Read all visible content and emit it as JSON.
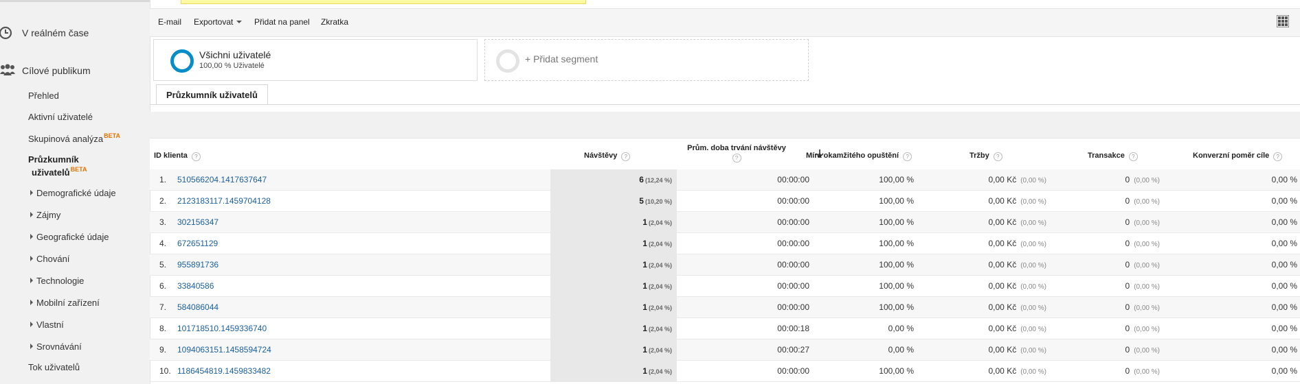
{
  "sidebar": {
    "realtime_label": "V reálném čase",
    "audience_label": "Cílové publikum",
    "items": [
      {
        "label": "Přehled"
      },
      {
        "label": "Aktivní uživatelé"
      },
      {
        "label": "Skupinová analýza",
        "badge": "BETA"
      },
      {
        "label_line1": "Průzkumník",
        "label_line2": "uživatelů",
        "badge": "BETA"
      },
      {
        "label": "Demografické údaje"
      },
      {
        "label": "Zájmy"
      },
      {
        "label": "Geografické údaje"
      },
      {
        "label": "Chování"
      },
      {
        "label": "Technologie"
      },
      {
        "label": "Mobilní zařízení"
      },
      {
        "label": "Vlastní"
      },
      {
        "label": "Srovnávání"
      },
      {
        "label": "Tok uživatelů"
      }
    ]
  },
  "toolbar": {
    "email": "E-mail",
    "export": "Exportovat",
    "add_to_dashboard": "Přidat na panel",
    "shortcut": "Zkratka"
  },
  "segments": {
    "all_users_title": "Všichni uživatelé",
    "all_users_sub": "100,00 % Uživatelé",
    "add_segment": "+ Přidat segment"
  },
  "tab": {
    "label": "Průzkumník uživatelů"
  },
  "table": {
    "headers": {
      "client_id": "ID klienta",
      "visits": "Návštěvy",
      "avg_duration": "Prům. doba trvání návštěvy",
      "bounce_rate": "Míra okamžitého opuštění",
      "revenue": "Tržby",
      "transactions": "Transakce",
      "conversion": "Konverzní poměr cíle"
    },
    "rows": [
      {
        "idx": "1.",
        "id": "510566204.1417637647",
        "visits": "6",
        "visits_pct": "(12,24 %)",
        "duration": "00:00:00",
        "bounce": "100,00 %",
        "revenue": "0,00 Kč",
        "revenue_pct": "(0,00 %)",
        "trans": "0",
        "trans_pct": "(0,00 %)",
        "conv": "0,00 %"
      },
      {
        "idx": "2.",
        "id": "2123183117.1459704128",
        "visits": "5",
        "visits_pct": "(10,20 %)",
        "duration": "00:00:00",
        "bounce": "100,00 %",
        "revenue": "0,00 Kč",
        "revenue_pct": "(0,00 %)",
        "trans": "0",
        "trans_pct": "(0,00 %)",
        "conv": "0,00 %"
      },
      {
        "idx": "3.",
        "id": "302156347",
        "visits": "1",
        "visits_pct": "(2,04 %)",
        "duration": "00:00:00",
        "bounce": "100,00 %",
        "revenue": "0,00 Kč",
        "revenue_pct": "(0,00 %)",
        "trans": "0",
        "trans_pct": "(0,00 %)",
        "conv": "0,00 %"
      },
      {
        "idx": "4.",
        "id": "672651129",
        "visits": "1",
        "visits_pct": "(2,04 %)",
        "duration": "00:00:00",
        "bounce": "100,00 %",
        "revenue": "0,00 Kč",
        "revenue_pct": "(0,00 %)",
        "trans": "0",
        "trans_pct": "(0,00 %)",
        "conv": "0,00 %"
      },
      {
        "idx": "5.",
        "id": "955891736",
        "visits": "1",
        "visits_pct": "(2,04 %)",
        "duration": "00:00:00",
        "bounce": "100,00 %",
        "revenue": "0,00 Kč",
        "revenue_pct": "(0,00 %)",
        "trans": "0",
        "trans_pct": "(0,00 %)",
        "conv": "0,00 %"
      },
      {
        "idx": "6.",
        "id": "33840586",
        "visits": "1",
        "visits_pct": "(2,04 %)",
        "duration": "00:00:00",
        "bounce": "100,00 %",
        "revenue": "0,00 Kč",
        "revenue_pct": "(0,00 %)",
        "trans": "0",
        "trans_pct": "(0,00 %)",
        "conv": "0,00 %"
      },
      {
        "idx": "7.",
        "id": "584086044",
        "visits": "1",
        "visits_pct": "(2,04 %)",
        "duration": "00:00:00",
        "bounce": "100,00 %",
        "revenue": "0,00 Kč",
        "revenue_pct": "(0,00 %)",
        "trans": "0",
        "trans_pct": "(0,00 %)",
        "conv": "0,00 %"
      },
      {
        "idx": "8.",
        "id": "101718510.1459336740",
        "visits": "1",
        "visits_pct": "(2,04 %)",
        "duration": "00:00:18",
        "bounce": "0,00 %",
        "revenue": "0,00 Kč",
        "revenue_pct": "(0,00 %)",
        "trans": "0",
        "trans_pct": "(0,00 %)",
        "conv": "0,00 %"
      },
      {
        "idx": "9.",
        "id": "1094063151.1458594724",
        "visits": "1",
        "visits_pct": "(2,04 %)",
        "duration": "00:00:27",
        "bounce": "0,00 %",
        "revenue": "0,00 Kč",
        "revenue_pct": "(0,00 %)",
        "trans": "0",
        "trans_pct": "(0,00 %)",
        "conv": "0,00 %"
      },
      {
        "idx": "10.",
        "id": "1186454819.1459833482",
        "visits": "1",
        "visits_pct": "(2,04 %)",
        "duration": "00:00:00",
        "bounce": "100,00 %",
        "revenue": "0,00 Kč",
        "revenue_pct": "(0,00 %)",
        "trans": "0",
        "trans_pct": "(0,00 %)",
        "conv": "0,00 %"
      }
    ]
  }
}
